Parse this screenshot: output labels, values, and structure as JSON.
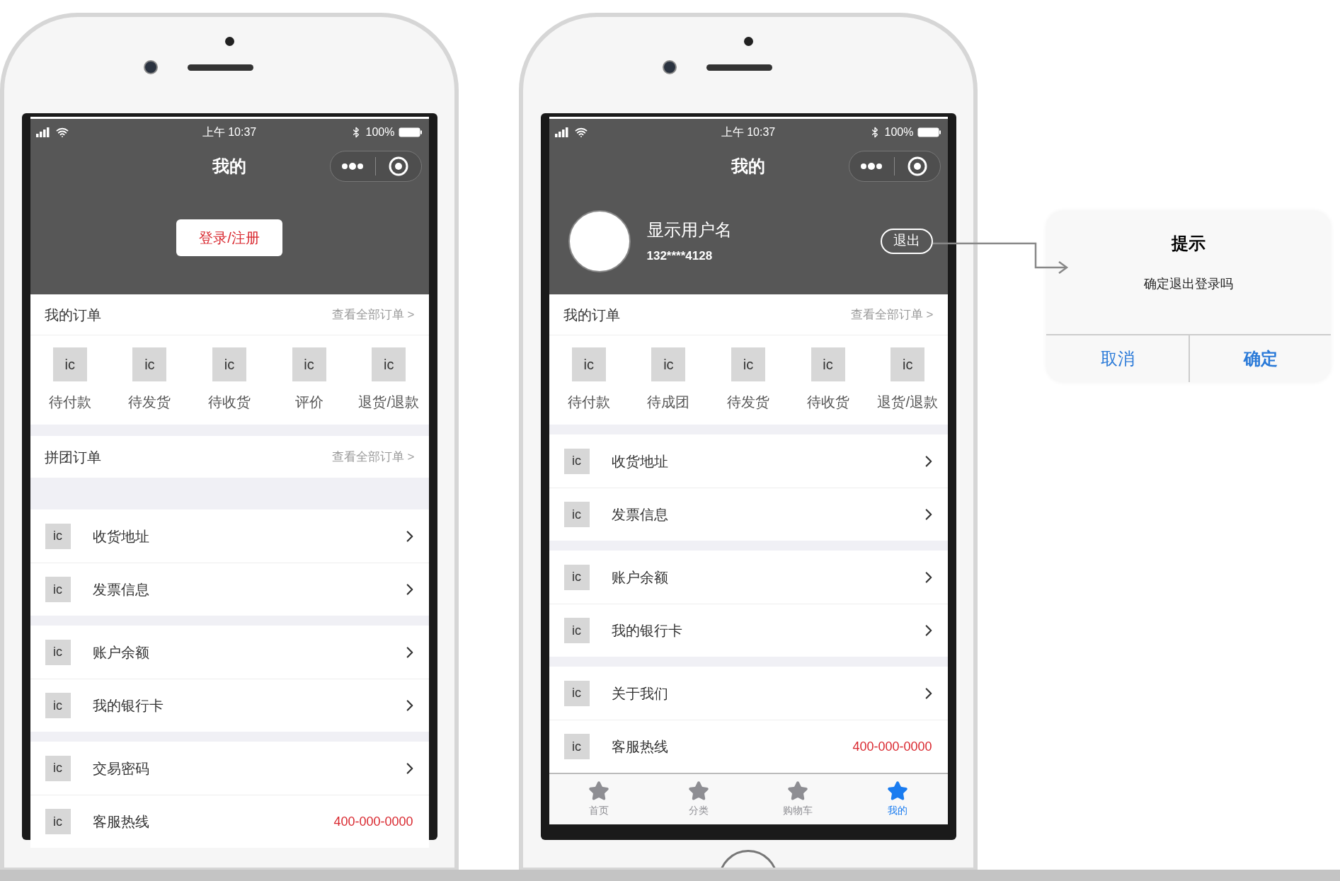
{
  "phones": [
    {
      "status_bar": {
        "time": "上午 10:37",
        "battery": "100%"
      },
      "nav": {
        "title": "我的"
      },
      "header": {
        "kind": "guest",
        "login_button": "登录/注册"
      },
      "sections": [
        {
          "kind": "orders",
          "title": "我的订单",
          "link": "查看全部订单 >",
          "items": [
            {
              "icon": "ic",
              "label": "待付款"
            },
            {
              "icon": "ic",
              "label": "待发货"
            },
            {
              "icon": "ic",
              "label": "待收货"
            },
            {
              "icon": "ic",
              "label": "评价"
            },
            {
              "icon": "ic",
              "label": "退货/退款"
            }
          ]
        },
        {
          "kind": "group_orders",
          "title": "拼团订单",
          "link": "查看全部订单 >"
        },
        {
          "kind": "menu",
          "items": [
            {
              "icon": "ic",
              "label": "收货地址"
            },
            {
              "icon": "ic",
              "label": "发票信息"
            }
          ]
        },
        {
          "kind": "menu",
          "items": [
            {
              "icon": "ic",
              "label": "账户余额"
            },
            {
              "icon": "ic",
              "label": "我的银行卡"
            }
          ]
        },
        {
          "kind": "menu",
          "items": [
            {
              "icon": "ic",
              "label": "交易密码"
            },
            {
              "icon": "ic",
              "label": "客服热线",
              "value": "400-000-0000"
            }
          ]
        }
      ]
    },
    {
      "status_bar": {
        "time": "上午 10:37",
        "battery": "100%"
      },
      "nav": {
        "title": "我的"
      },
      "header": {
        "kind": "user",
        "name": "显示用户名",
        "phone": "132****4128",
        "logout_button": "退出"
      },
      "sections": [
        {
          "kind": "orders",
          "title": "我的订单",
          "link": "查看全部订单 >",
          "items": [
            {
              "icon": "ic",
              "label": "待付款"
            },
            {
              "icon": "ic",
              "label": "待成团"
            },
            {
              "icon": "ic",
              "label": "待发货"
            },
            {
              "icon": "ic",
              "label": "待收货"
            },
            {
              "icon": "ic",
              "label": "退货/退款"
            }
          ]
        },
        {
          "kind": "menu",
          "items": [
            {
              "icon": "ic",
              "label": "收货地址"
            },
            {
              "icon": "ic",
              "label": "发票信息"
            }
          ]
        },
        {
          "kind": "menu",
          "items": [
            {
              "icon": "ic",
              "label": "账户余额"
            },
            {
              "icon": "ic",
              "label": "我的银行卡"
            }
          ]
        },
        {
          "kind": "menu",
          "items": [
            {
              "icon": "ic",
              "label": "关于我们"
            },
            {
              "icon": "ic",
              "label": "客服热线",
              "value": "400-000-0000"
            }
          ]
        }
      ],
      "tab_bar": [
        {
          "label": "首页",
          "selected": false
        },
        {
          "label": "分类",
          "selected": false
        },
        {
          "label": "购物车",
          "selected": false
        },
        {
          "label": "我的",
          "selected": true
        }
      ]
    }
  ],
  "dialog": {
    "title": "提示",
    "message": "确定退出登录吗",
    "buttons": [
      {
        "label": "取消",
        "kind": "cancel"
      },
      {
        "label": "确定",
        "kind": "confirm"
      }
    ]
  }
}
